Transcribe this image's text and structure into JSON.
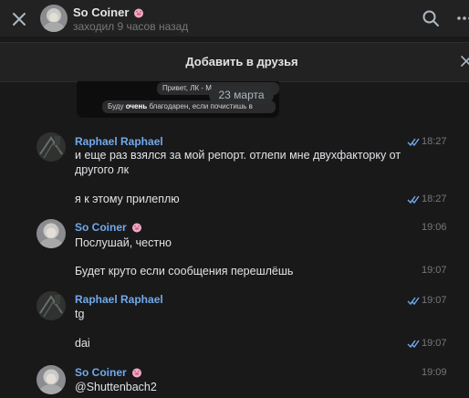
{
  "header": {
    "name": "So Coiner",
    "status": "заходил 9 часов назад"
  },
  "friend_bar": {
    "label": "Добавить в друзья"
  },
  "preview": {
    "line1": "Привет, ЛК - М",
    "line2_bold": "очень",
    "line2_pre": "Буду ",
    "line2_post": " благодарен, если почистишь в",
    "date": "23 марта"
  },
  "messages": [
    {
      "sender": "Raphael Raphael",
      "text_lines": [
        "и еще раз взялся за мой репорт. отлепи мне двухфакторку от",
        "другого лк"
      ],
      "time": "18:27",
      "read": true
    },
    {
      "text": "я к этому прилеплю",
      "time": "18:27",
      "read": true
    },
    {
      "sender": "So Coiner",
      "text": "Послушай, честно",
      "time": "19:06"
    },
    {
      "text": "Будет круто если сообщения перешлёшь",
      "time": "19:07"
    },
    {
      "sender": "Raphael Raphael",
      "text": "tg",
      "time": "19:07",
      "read": true
    },
    {
      "text": "dai",
      "time": "19:07",
      "read": true
    },
    {
      "sender": "So Coiner",
      "text": "@Shuttenbach2",
      "time": "19:09"
    }
  ]
}
